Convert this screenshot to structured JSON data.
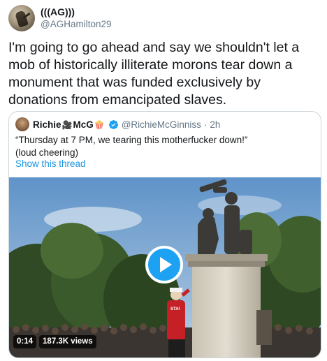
{
  "author": {
    "display_name": "(((AG)))",
    "handle": "@AGHamilton29"
  },
  "tweet": {
    "text": "I'm going to go ahead and say we shouldn't let a mob of historically illiterate morons tear down a monument that was funded exclusively by donations from emancipated slaves."
  },
  "quoted_tweet": {
    "display_name": "Richie",
    "name_suffix": "McG",
    "emoji_1": "🎥",
    "emoji_2": "🍿",
    "handle": "@RichieMcGinniss",
    "separator": "·",
    "timestamp": "2h",
    "text_line_1": "“Thursday at 7 PM, we tearing this motherfucker down!”",
    "text_line_2": "(loud cheering)",
    "show_thread_label": "Show this thread"
  },
  "video": {
    "duration": "0:14",
    "views": "187.3K views",
    "shirt_text": "STAI"
  },
  "colors": {
    "link": "#1b95e0",
    "play_button": "#1da1f2",
    "verified": "#1da1f2",
    "border": "#ccd6dd",
    "secondary_text": "#657786"
  },
  "icons": [
    "verified-badge-icon",
    "play-icon",
    "movie-camera-emoji",
    "popcorn-emoji"
  ]
}
